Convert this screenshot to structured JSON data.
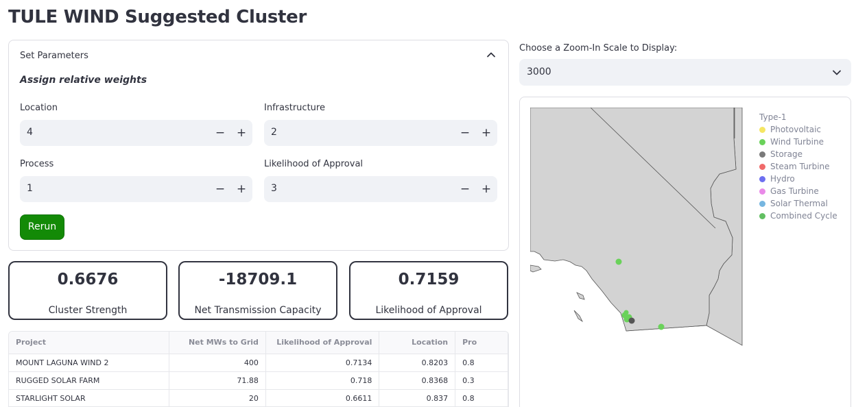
{
  "page": {
    "title": "TULE WIND Suggested Cluster"
  },
  "params": {
    "header": "Set Parameters",
    "subheader": "Assign relative weights",
    "inputs": {
      "location": {
        "label": "Location",
        "value": "4"
      },
      "infrastructure": {
        "label": "Infrastructure",
        "value": "2"
      },
      "process": {
        "label": "Process",
        "value": "1"
      },
      "approval": {
        "label": "Likelihood of Approval",
        "value": "3"
      }
    },
    "step_minus": "−",
    "step_plus": "+",
    "rerun_label": "Rerun"
  },
  "metrics": [
    {
      "value": "0.6676",
      "label": "Cluster Strength"
    },
    {
      "value": "-18709.1",
      "label": "Net Transmission Capacity"
    },
    {
      "value": "0.7159",
      "label": "Likelihood of Approval"
    }
  ],
  "table": {
    "headers": [
      "Project",
      "Net MWs to Grid",
      "Likelihood of Approval",
      "Location",
      "Pro"
    ],
    "rows": [
      [
        "MOUNT LAGUNA WIND 2",
        "400",
        "0.7134",
        "0.8203",
        "0.8"
      ],
      [
        "RUGGED SOLAR FARM",
        "71.88",
        "0.718",
        "0.8368",
        "0.3"
      ],
      [
        "STARLIGHT SOLAR",
        "20",
        "0.6611",
        "0.837",
        "0.8"
      ]
    ]
  },
  "zoom": {
    "label": "Choose a Zoom-In Scale to Display:",
    "value": "3000"
  },
  "map": {
    "legend_title": "Type-1",
    "legend": [
      {
        "name": "Photovoltaic",
        "color": "#f5e663"
      },
      {
        "name": "Wind Turbine",
        "color": "#6ad25a"
      },
      {
        "name": "Storage",
        "color": "#7a7a7a"
      },
      {
        "name": "Steam Turbine",
        "color": "#f06a6a"
      },
      {
        "name": "Hydro",
        "color": "#6d6ff0"
      },
      {
        "name": "Gas Turbine",
        "color": "#e98ae8"
      },
      {
        "name": "Solar Thermal",
        "color": "#76b6e0"
      },
      {
        "name": "Combined Cycle",
        "color": "#62bf62"
      }
    ],
    "colors": {
      "land": "#d3d3d3",
      "border": "#555555",
      "ocean": "#ffffff"
    }
  }
}
